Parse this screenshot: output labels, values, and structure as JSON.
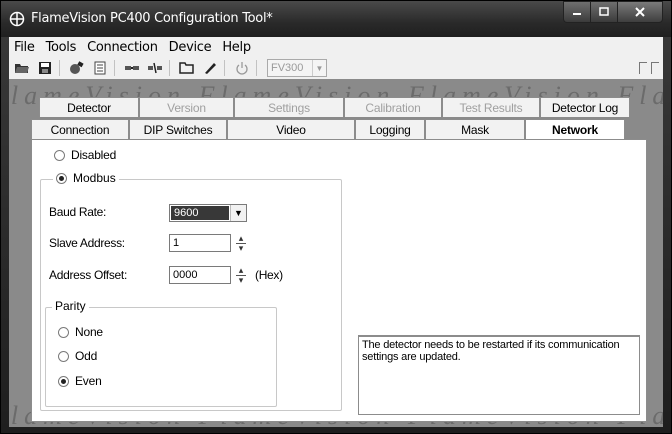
{
  "window": {
    "title": "FlameVision PC400 Configuration Tool*"
  },
  "menu": [
    "File",
    "Tools",
    "Connection",
    "Device",
    "Help"
  ],
  "toolbar": {
    "icons": [
      "open-folder-icon",
      "save-icon",
      "tools-icon",
      "document-icon",
      "connect-icon",
      "disconnect-icon",
      "folder-open-icon",
      "pen-icon",
      "power-icon"
    ],
    "device_combo": "FV300"
  },
  "tabs_back": [
    "Detector",
    "Version",
    "Settings",
    "Calibration",
    "Test Results",
    "Detector Log"
  ],
  "tabs_front": [
    "Connection",
    "DIP Switches",
    "Video",
    "Logging",
    "Mask",
    "Network"
  ],
  "active_tab": "Network",
  "network": {
    "disabled_label": "Disabled",
    "modbus_label": "Modbus",
    "selected": "Modbus",
    "baud_rate_label": "Baud Rate:",
    "baud_rate_value": "9600",
    "slave_address_label": "Slave Address:",
    "slave_address_value": "1",
    "address_offset_label": "Address Offset:",
    "address_offset_value": "0000",
    "address_offset_unit": "(Hex)",
    "parity_label": "Parity",
    "parity_options": [
      "None",
      "Odd",
      "Even"
    ],
    "parity_selected": "Even",
    "info_text": "The detector needs to be restarted if its communication settings are updated."
  },
  "watermark": "FlameVision FlameVision FlameVision FlameVision"
}
